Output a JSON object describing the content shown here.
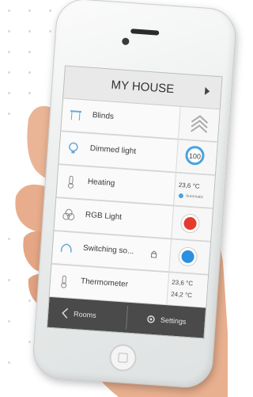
{
  "header": {
    "title": "MY HOUSE"
  },
  "rows": [
    {
      "label": "Blinds",
      "icon": "blinds-icon"
    },
    {
      "label": "Dimmed light",
      "icon": "bulb-icon",
      "value": "100"
    },
    {
      "label": "Heating",
      "icon": "thermometer-icon",
      "value": "23,6 °C",
      "sub": "Automatic"
    },
    {
      "label": "RGB Light",
      "icon": "rgb-icon",
      "dot_color": "#e53b2c"
    },
    {
      "label": "Switching so...",
      "icon": "socket-icon",
      "dot_color": "#2d8fe0"
    },
    {
      "label": "Thermometer",
      "icon": "thermometer-icon",
      "value1": "23,6 °C",
      "value2": "24,2 °C"
    }
  ],
  "bottom": {
    "rooms": "Rooms",
    "settings": "Settings"
  },
  "colors": {
    "accent": "#4aa3df",
    "red": "#e53b2c",
    "blue": "#2d8fe0",
    "bar": "#4a4a4a"
  }
}
